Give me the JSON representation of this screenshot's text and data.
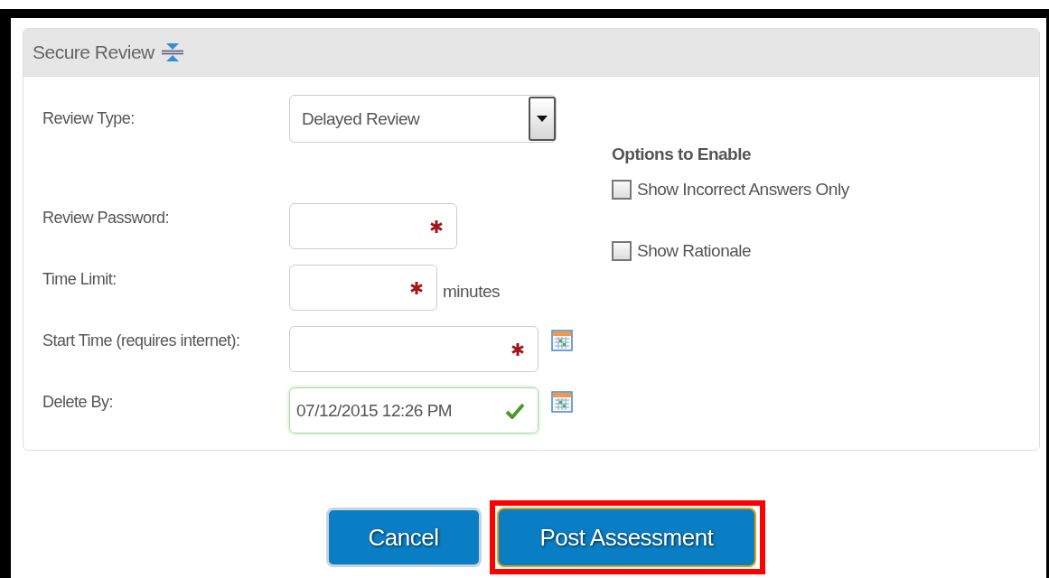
{
  "panel": {
    "title": "Secure Review",
    "expanded": true
  },
  "review_type": {
    "label": "Review Type:",
    "value": "Delayed Review"
  },
  "options": {
    "heading": "Options to Enable",
    "items": [
      {
        "label": "Show Incorrect Answers Only",
        "checked": false
      },
      {
        "label": "Show Rationale",
        "checked": false
      }
    ]
  },
  "fields": [
    {
      "label": "Review Password:",
      "required": true,
      "valid": false,
      "calendar": false
    },
    {
      "label": "Time Limit:",
      "required": true,
      "valid": false,
      "suffix": "minutes",
      "calendar": false
    },
    {
      "label": "Start Time (requires internet):",
      "required": true,
      "valid": false,
      "calendar": true
    },
    {
      "label": "Delete By:",
      "value": "07/12/2015 12:26 PM",
      "required": false,
      "valid": true,
      "calendar": true
    }
  ],
  "buttons": [
    {
      "label": "Cancel",
      "highlighted": false
    },
    {
      "label": "Post Assessment",
      "highlighted": true
    }
  ]
}
